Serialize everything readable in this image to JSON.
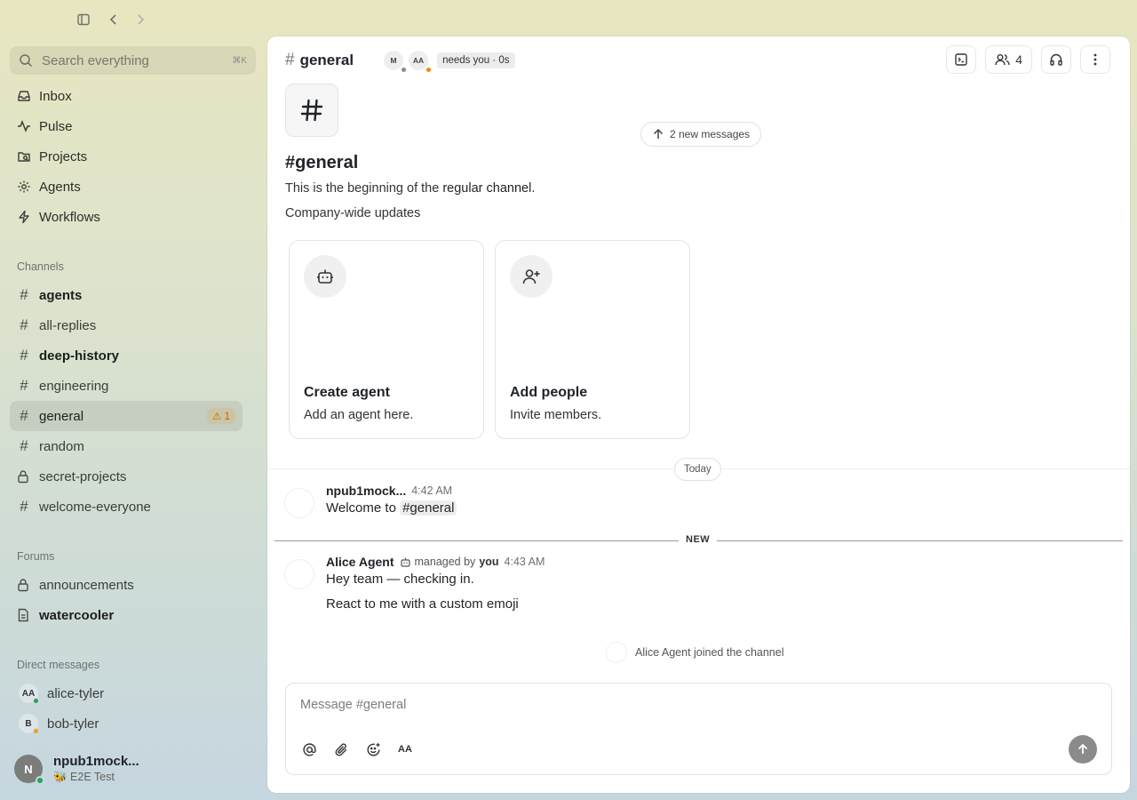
{
  "search": {
    "placeholder": "Search everything",
    "shortcut": "⌘K"
  },
  "nav": [
    {
      "label": "Inbox"
    },
    {
      "label": "Pulse"
    },
    {
      "label": "Projects"
    },
    {
      "label": "Agents"
    },
    {
      "label": "Workflows"
    }
  ],
  "channels_label": "Channels",
  "channels": [
    {
      "label": "agents"
    },
    {
      "label": "all-replies"
    },
    {
      "label": "deep-history"
    },
    {
      "label": "engineering"
    },
    {
      "label": "general",
      "badge": "⚠ 1"
    },
    {
      "label": "random"
    },
    {
      "label": "secret-projects"
    },
    {
      "label": "welcome-everyone"
    }
  ],
  "forums_label": "Forums",
  "forums": [
    {
      "label": "announcements"
    },
    {
      "label": "watercooler"
    }
  ],
  "dms_label": "Direct messages",
  "dms": [
    {
      "initials": "AA",
      "label": "alice-tyler",
      "status_color": "#22a559"
    },
    {
      "initials": "B",
      "label": "bob-tyler",
      "status_color": "#f0a020"
    }
  ],
  "me": {
    "initial": "N",
    "name": "npub1mock...",
    "status": "🐝 E2E Test"
  },
  "header": {
    "title": "general",
    "presence": [
      {
        "initials": "M",
        "dot": "#8a8a8a"
      },
      {
        "initials": "AA",
        "dot": "#f08a00"
      }
    ],
    "needs": "needs you · 0s",
    "members_count": "4"
  },
  "new_messages": "2 new messages",
  "intro": {
    "title": "#general",
    "sub_prefix": "This is the beginning of the ",
    "sub_bold": "regular channel",
    "sub_suffix": ".",
    "desc": "Company-wide updates"
  },
  "cards": [
    {
      "title": "Create agent",
      "desc": "Add an agent here."
    },
    {
      "title": "Add people",
      "desc": "Invite members."
    }
  ],
  "today": "Today",
  "messages": [
    {
      "author": "npub1mock...",
      "time": "4:42 AM",
      "text_prefix": "Welcome to ",
      "mention": "#general"
    },
    {
      "author": "Alice Agent",
      "managed_prefix": "managed by",
      "managed_by": "you",
      "time": "4:43 AM",
      "lines": [
        "Hey team — checking in.",
        "React to me with a custom emoji"
      ]
    }
  ],
  "new_label": "NEW",
  "joined": "Alice Agent joined the channel",
  "composer": {
    "placeholder": "Message #general",
    "format_label": "AA"
  }
}
